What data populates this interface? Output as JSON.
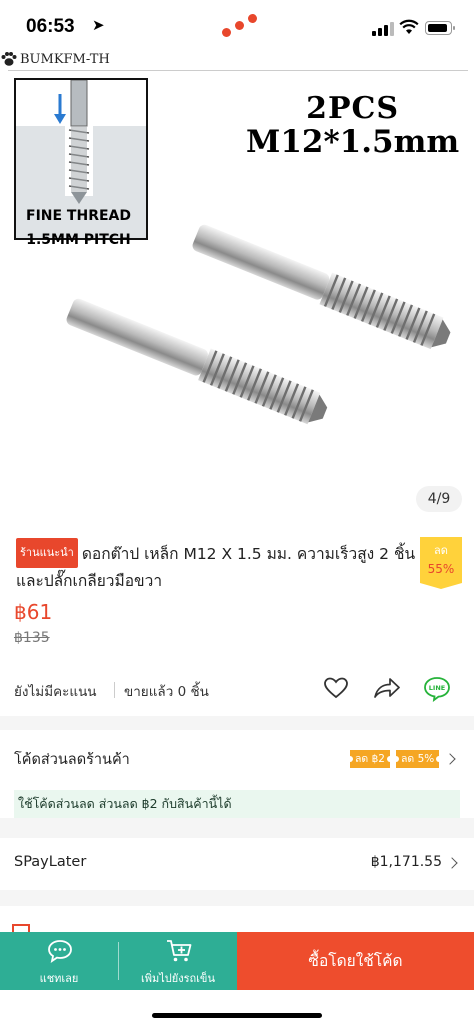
{
  "status_bar": {
    "time": "06:53",
    "nav_arrow": "➤"
  },
  "product_image": {
    "brand": "BUMKFM-TH",
    "headline_line1": "2PCS",
    "headline_line2": "M12*1.5mm",
    "caption_line1": "FINE THREAD",
    "caption_line2": "1.5MM PITCH",
    "counter": "4/9"
  },
  "product": {
    "shop_badge": "ร้านแนะนำ",
    "title": "ดอกต๊าป เหล็ก M12 X 1.5 มม. ความเร็วสูง 2 ชิ้น และปลั๊กเกลียวมือขวา",
    "discount_label": "ลด",
    "discount_value": "55%",
    "price": "฿61",
    "old_price": "฿135",
    "rating_text": "ยังไม่มีคะแนน",
    "sold_text": "ขายแล้ว 0 ชิ้น",
    "line_label": "LINE"
  },
  "voucher": {
    "label": "โค้ดส่วนลดร้านค้า",
    "tags": [
      "ลด ฿2",
      "ลด 5%"
    ],
    "note": "ใช้โค้ดส่วนลด ส่วนลด ฿2 กับสินค้านี้ได้"
  },
  "spaylater": {
    "label": "SPayLater",
    "amount": "฿1,171.55"
  },
  "bottom_bar": {
    "chat_label": "แชทเลย",
    "cart_label": "เพิ่มไปยังรถเข็น",
    "buy_label": "ซื้อโดยใช้โค้ด"
  },
  "colors": {
    "accent": "#ee4d2d",
    "chat_bar": "#2eae95",
    "badge_yellow": "#ffd23b",
    "voucher_tag": "#f5a623"
  }
}
